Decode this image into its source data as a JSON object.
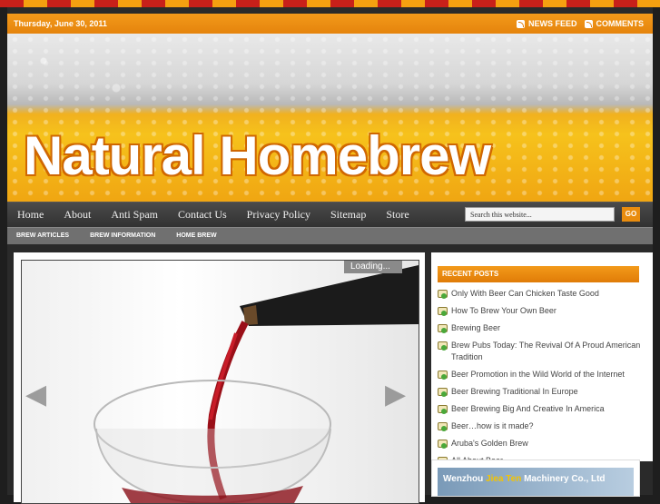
{
  "topbar": {
    "date": "Thursday, June 30, 2011",
    "links": [
      {
        "label": "NEWS FEED",
        "icon": "rss-icon"
      },
      {
        "label": "COMMENTS",
        "icon": "rss-icon"
      }
    ]
  },
  "header": {
    "site_title": "Natural Homebrew"
  },
  "nav": {
    "items": [
      "Home",
      "About",
      "Anti Spam",
      "Contact Us",
      "Privacy Policy",
      "Sitemap",
      "Store"
    ],
    "search_placeholder": "Search this website...",
    "go_label": "GO"
  },
  "subnav": {
    "items": [
      "BREW ARTICLES",
      "BREW INFORMATION",
      "HOME BREW"
    ]
  },
  "slider": {
    "loading_label": "Loading..."
  },
  "sidebar": {
    "recent_posts_title": "RECENT POSTS",
    "posts": [
      "Only With Beer Can Chicken Taste Good",
      "How To Brew Your Own Beer",
      "Brewing Beer",
      "Brew Pubs Today: The Revival Of A Proud American Tradition",
      "Beer Promotion in the Wild World of the Internet",
      "Beer Brewing Traditional In Europe",
      "Beer Brewing Big And Creative In America",
      "Beer…how is it made?",
      "Aruba's Golden Brew",
      "All About Beer"
    ]
  },
  "ad": {
    "text_pre": "Wenzhou ",
    "text_highlight": "Jiea Ten",
    "text_post": " Machinery Co., Ltd"
  },
  "colors": {
    "accent": "#e98c0e",
    "nav_bg": "#3a3a3a",
    "page_bg": "#1e1e1e"
  }
}
